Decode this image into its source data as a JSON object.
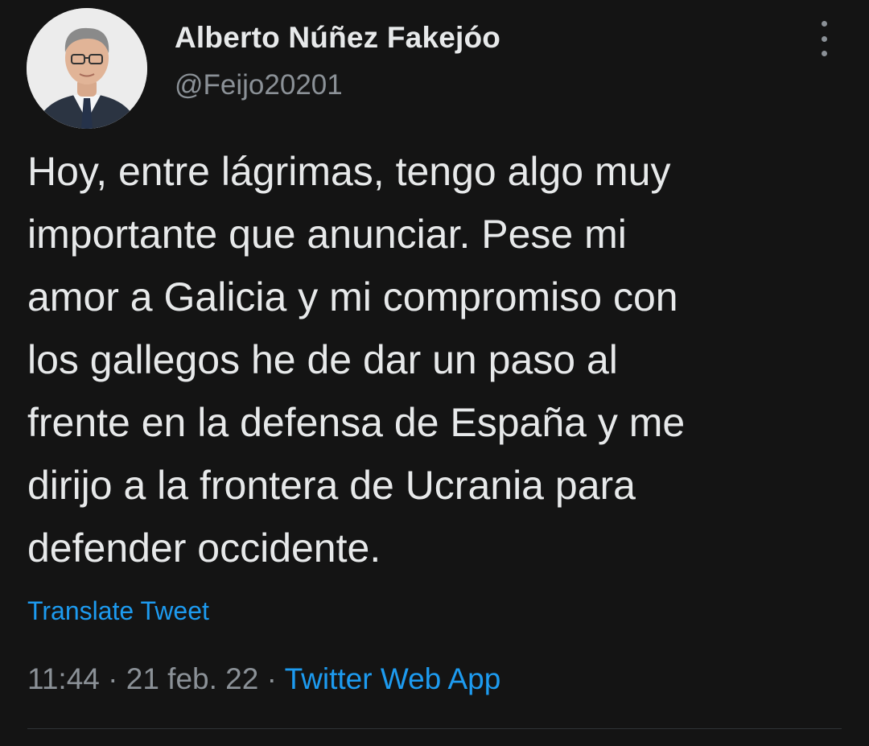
{
  "tweet": {
    "author": {
      "display_name": "Alberto Núñez Fakejóo",
      "handle": "@Feijo20201",
      "avatar_icon": "profile-photo"
    },
    "more_icon": "more-vertical-icon",
    "text_lines": [
      "Hoy, entre lágrimas, tengo algo muy",
      "importante que anunciar. Pese mi",
      "amor a Galicia y mi compromiso con",
      "los gallegos he de dar un paso al",
      "frente en la defensa de España y me",
      "dirijo a la frontera de Ucrania para",
      "defender occidente."
    ],
    "translate_label": "Translate Tweet",
    "time": "11:44",
    "separator": "·",
    "date": "21 feb. 22",
    "source": "Twitter Web App"
  },
  "colors": {
    "background": "#141414",
    "text": "#e7e9ea",
    "secondary": "#8b9197",
    "link": "#1d9bf0"
  }
}
